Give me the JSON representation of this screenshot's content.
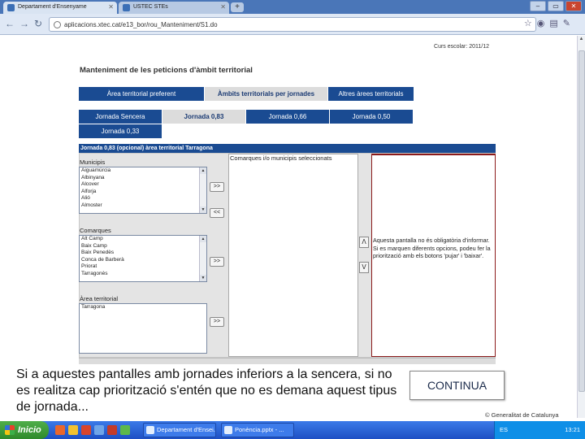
{
  "browser": {
    "tabs": [
      {
        "label": "Departament d'Ensenyame"
      },
      {
        "label": "USTEC STEs"
      }
    ],
    "url": "aplicacions.xtec.cat/e13_bor/rou_Manteniment/S1.do"
  },
  "page": {
    "school_year": "Curs escolar: 2011/12",
    "heading": "Manteniment de les peticions d'àmbit territorial",
    "main_tabs": [
      {
        "label": "Àrea territorial preferent"
      },
      {
        "label": "Àmbits territorials per jornades"
      },
      {
        "label": "Altres àrees territorials"
      }
    ],
    "jornada_tabs": [
      {
        "label": "Jornada Sencera"
      },
      {
        "label": "Jornada 0,83"
      },
      {
        "label": "Jornada 0,66"
      },
      {
        "label": "Jornada 0,50"
      },
      {
        "label": "Jornada 0,33"
      }
    ],
    "section_title": "Jornada 0,83 (opcional) àrea territorial Tarragona",
    "municipis": {
      "label": "Municipis",
      "items": [
        "Aiguamúrcia",
        "Albinyana",
        "Alcover",
        "Alforja",
        "Alió",
        "Almoster"
      ]
    },
    "comarques": {
      "label": "Comarques",
      "items": [
        "Alt Camp",
        "Baix Camp",
        "Baix Penedès",
        "Conca de Barberà",
        "Priorat",
        "Tarragonès"
      ]
    },
    "area_territorial": {
      "label": "Àrea territorial",
      "items": [
        "Tarragona"
      ]
    },
    "add_button": ">>",
    "remove_button": "<<",
    "selected_title": "Comarques i/o municipis seleccionats",
    "order_up": "Λ",
    "order_down": "V",
    "help_text": "Aquesta pantalla no és obligatòria d'informar. Si es marquen diferents opcions, podeu fer la priorització amb els botons 'pujar' i 'baixar'."
  },
  "overlay": {
    "caption": "Si a aquestes pantalles amb jornades inferiors a la sencera, si no es realitza cap priorització  s'entén que no es demana aquest tipus de jornada...",
    "continue_button": "CONTINUA",
    "footer": "© Generalitat de Catalunya"
  },
  "taskbar": {
    "start_label": "Inicio",
    "tasks": [
      {
        "label": "Departament d'Ensei..."
      },
      {
        "label": "Ponència.pptx - ..."
      }
    ],
    "language": "ES",
    "clock": "13:21"
  }
}
